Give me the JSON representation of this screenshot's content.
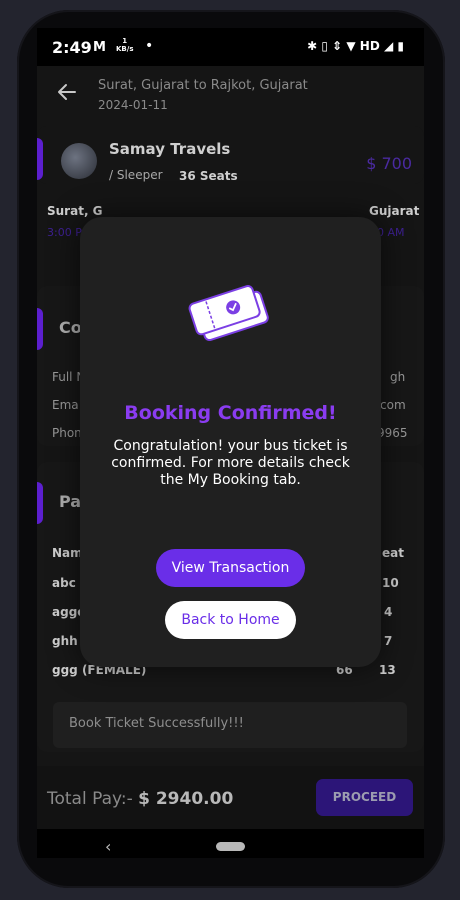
{
  "status_bar": {
    "time": "2:49",
    "mail_icon": "M",
    "kbs_top": "1",
    "kbs_bottom": "KB/s",
    "dot": "•",
    "right_icons": "✱ ▯ ⇕ ▼ HD ◢ ▮"
  },
  "header": {
    "route": "Surat, Gujarat  to  Rajkot, Gujarat",
    "date": "2024-01-11"
  },
  "bus": {
    "name": "Samay Travels",
    "type": "/ Sleeper",
    "seats": "36 Seats",
    "price": "$ 700"
  },
  "journey": {
    "from_city": "Surat, G",
    "to_city": "Gujarat",
    "from_time": "3:00 P",
    "to_time": "0 AM"
  },
  "contact": {
    "title": "Co",
    "rows": [
      {
        "label": "Full N",
        "value": "gh"
      },
      {
        "label": "Ema",
        "value": "com"
      },
      {
        "label": "Phon",
        "value": "9965"
      }
    ]
  },
  "passengers": {
    "title": "Pa",
    "header_left": "Nam",
    "header_right": "eat",
    "rows": [
      {
        "name": "abc (",
        "age": "",
        "seat": "10"
      },
      {
        "name": "aggc",
        "age": "",
        "seat": "4"
      },
      {
        "name": "ghh (",
        "age": "",
        "seat": "7"
      },
      {
        "name": "ggg (FEMALE)",
        "age": "66",
        "seat": "13"
      }
    ]
  },
  "success_message": "Book Ticket Successfully!!!",
  "footer": {
    "total_label": "Total Pay:- ",
    "total_value": "$ 2940.00",
    "proceed_label": "PROCEED"
  },
  "nav": {
    "back": "‹"
  },
  "modal": {
    "title": "Booking Confirmed!",
    "message": "Congratulation! your bus ticket is confirmed. For more details check the My Booking tab.",
    "view_button": "View Transaction",
    "home_button": "Back to Home"
  },
  "colors": {
    "accent": "#6a2ee8",
    "title_purple": "#8a3cf0"
  }
}
